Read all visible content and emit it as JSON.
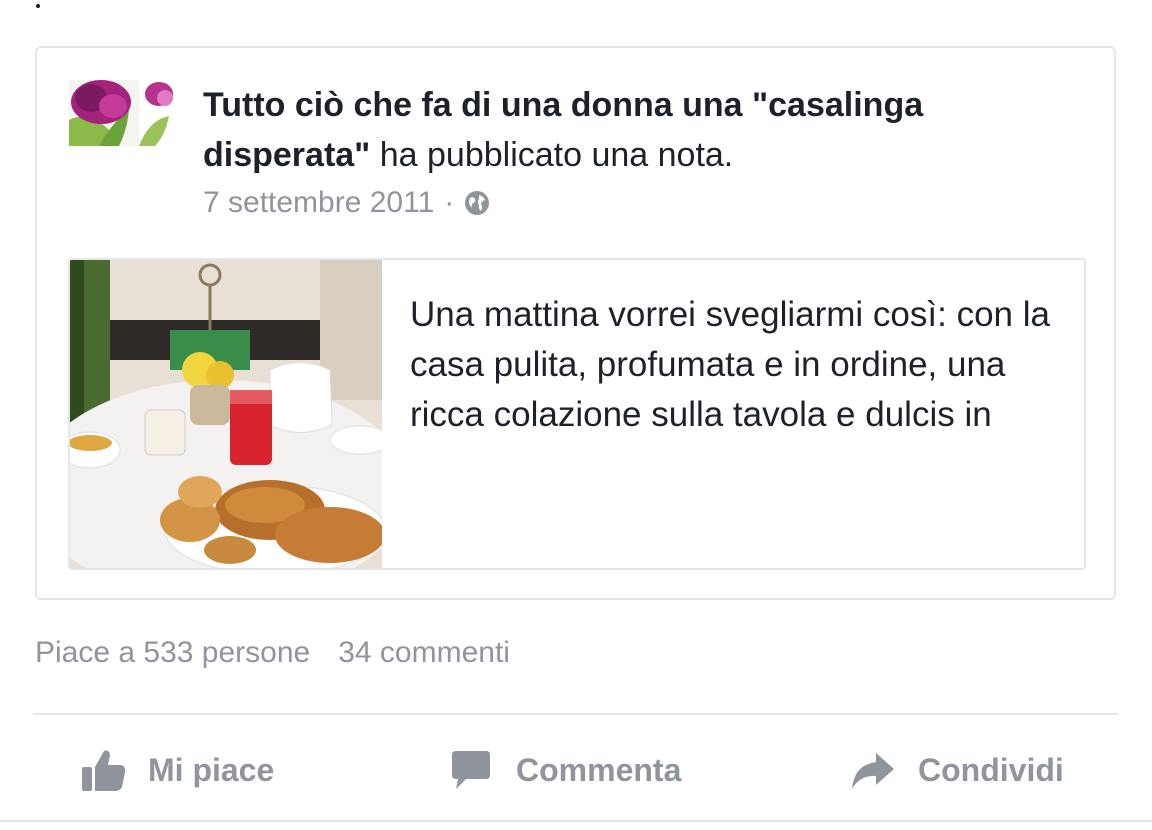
{
  "post": {
    "page_name": "Tutto ciò che fa di una donna una \"casalinga disperata\"",
    "action_text": " ha pubblicato una nota.",
    "date": "7 settembre 2011",
    "separator": "·",
    "privacy_icon": "globe-icon",
    "avatar_icon": "tulip-flower-photo"
  },
  "note": {
    "image": "breakfast-table-photo",
    "excerpt": "Una mattina vorrei svegliarmi così: con la casa pulita, profumata e in ordine, una ricca colazione sulla tavola e dulcis in"
  },
  "stats": {
    "likes": "Piace a 533 persone",
    "comments": "34 commenti"
  },
  "actions": {
    "like": "Mi piace",
    "comment": "Commenta",
    "share": "Condividi"
  },
  "colors": {
    "text": "#1d2129",
    "muted": "#90949c",
    "border": "#e4e6eb"
  }
}
